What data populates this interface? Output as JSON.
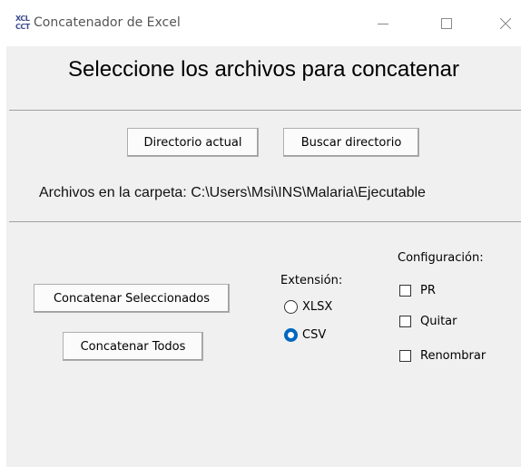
{
  "window": {
    "title": "Concatenador de Excel",
    "icon_text_top": "XCL",
    "icon_text_bottom": "CCT",
    "controls": [
      "minimize",
      "maximize",
      "close"
    ]
  },
  "header": {
    "title": "Seleccione los archivos para concatenar"
  },
  "directory": {
    "current_button": "Directorio actual",
    "search_button": "Buscar directorio",
    "folder_label": "Archivos en la carpeta: C:\\Users\\Msi\\INS\\Malaria\\Ejecutable"
  },
  "actions": {
    "concat_selected": "Concatenar Seleccionados",
    "concat_all": "Concatenar Todos"
  },
  "extension": {
    "label": "Extensión:",
    "options": [
      {
        "label": "XLSX",
        "selected": false
      },
      {
        "label": "CSV",
        "selected": true
      }
    ]
  },
  "configuration": {
    "label": "Configuración:",
    "options": [
      {
        "label": "PR",
        "checked": false
      },
      {
        "label": "Quitar",
        "checked": false
      },
      {
        "label": "Renombrar",
        "checked": false
      }
    ]
  },
  "colors": {
    "accent": "#0067c0",
    "window_bg": "#f0f0f0",
    "titlebar_bg": "#ffffff"
  }
}
